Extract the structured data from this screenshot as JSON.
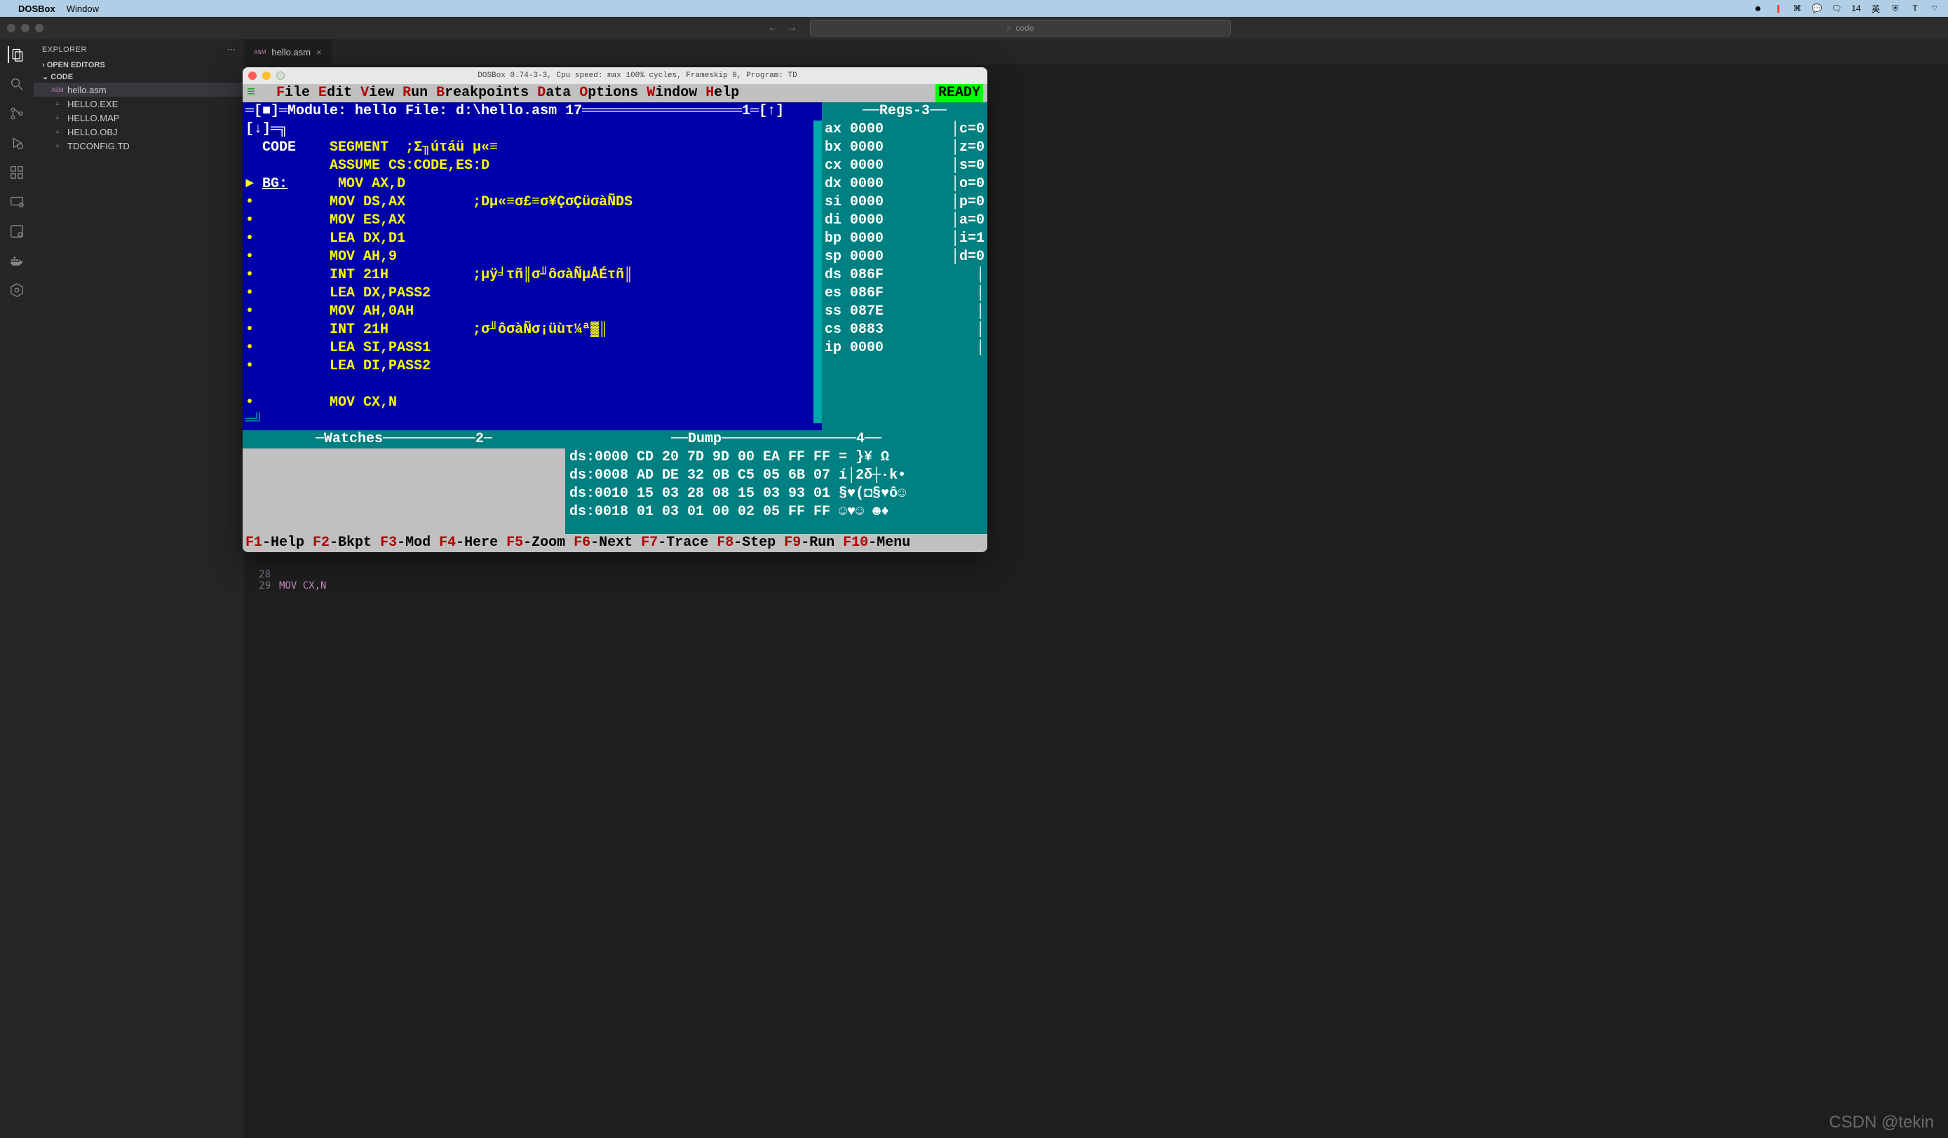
{
  "mac_menu": {
    "app": "DOSBox",
    "items": [
      "Window"
    ],
    "right_status": "14"
  },
  "vsc": {
    "search_placeholder": "code",
    "explorer": {
      "title": "EXPLORER",
      "sections": {
        "open_editors": "OPEN EDITORS",
        "code": "CODE"
      },
      "files": [
        {
          "name": "hello.asm",
          "icon": "asm",
          "active": true
        },
        {
          "name": "HELLO.EXE",
          "icon": "txt"
        },
        {
          "name": "HELLO.MAP",
          "icon": "txt"
        },
        {
          "name": "HELLO.OBJ",
          "icon": "txt"
        },
        {
          "name": "TDCONFIG.TD",
          "icon": "txt"
        }
      ]
    },
    "tab": {
      "label": "hello.asm",
      "icon_label": "ASM"
    },
    "editor_lines": [
      {
        "no": "28",
        "code": ""
      },
      {
        "no": "29",
        "code": "MOV CX,N"
      }
    ]
  },
  "dosbox": {
    "title": "DOSBox 0.74-3-3, Cpu speed: max 100% cycles, Frameskip  0, Program:     TD",
    "menu": [
      "File",
      "Edit",
      "View",
      "Run",
      "Breakpoints",
      "Data",
      "Options",
      "Window",
      "Help"
    ],
    "ready": "READY",
    "module_title": "═[■]═Module: hello File: d:\\hello.asm 17═══════════════════1═[↑][↓]═╗",
    "code_lines": [
      {
        "marker": " ",
        "label": "CODE",
        "instr": "SEGMENT  ;Σ╖úτáü µ«≡"
      },
      {
        "marker": " ",
        "label": "",
        "instr": "ASSUME CS:CODE,ES:D"
      },
      {
        "marker": "►",
        "label": "BG:",
        "instr": "MOV AX,D",
        "underline": true
      },
      {
        "marker": "•",
        "label": "",
        "instr": "MOV DS,AX        ;Dµ«≡σ£≡σ¥ÇσÇüσàÑDS"
      },
      {
        "marker": "•",
        "label": "",
        "instr": "MOV ES,AX"
      },
      {
        "marker": "•",
        "label": "",
        "instr": "LEA DX,D1"
      },
      {
        "marker": "•",
        "label": "",
        "instr": "MOV AH,9"
      },
      {
        "marker": "•",
        "label": "",
        "instr": "INT 21H          ;µÿ╛τñ║σ╜ôσàÑµÅÉτñ║"
      },
      {
        "marker": "•",
        "label": "",
        "instr": "LEA DX,PASS2"
      },
      {
        "marker": "•",
        "label": "",
        "instr": "MOV AH,0AH"
      },
      {
        "marker": "•",
        "label": "",
        "instr": "INT 21H          ;σ╜ôσàÑσ¡üùτ¼ª▓║"
      },
      {
        "marker": "•",
        "label": "",
        "instr": "LEA SI,PASS1"
      },
      {
        "marker": "•",
        "label": "",
        "instr": "LEA DI,PASS2"
      },
      {
        "marker": " ",
        "label": "",
        "instr": ""
      },
      {
        "marker": "•",
        "label": "",
        "instr": "MOV CX,N"
      }
    ],
    "regs_title": "Regs-3",
    "regs": [
      {
        "l": "ax 0000",
        "r": "c=0"
      },
      {
        "l": "bx 0000",
        "r": "z=0"
      },
      {
        "l": "cx 0000",
        "r": "s=0"
      },
      {
        "l": "dx 0000",
        "r": "o=0"
      },
      {
        "l": "si 0000",
        "r": "p=0"
      },
      {
        "l": "di 0000",
        "r": "a=0"
      },
      {
        "l": "bp 0000",
        "r": "i=1"
      },
      {
        "l": "sp 0000",
        "r": "d=0"
      },
      {
        "l": "ds 086F",
        "r": ""
      },
      {
        "l": "es 086F",
        "r": ""
      },
      {
        "l": "ss 087E",
        "r": ""
      },
      {
        "l": "cs 0883",
        "r": ""
      },
      {
        "l": "ip 0000",
        "r": ""
      }
    ],
    "watches_title": "─Watches───────────2─",
    "dump_title": "──Dump────────────────4──",
    "dump_lines": [
      "ds:0000 CD 20 7D 9D 00 EA FF FF = }¥ Ω",
      "ds:0008 AD DE 32 0B C5 05 6B 07 í│2δ┼∙k•",
      "ds:0010 15 03 28 08 15 03 93 01 §♥(◘§♥ô☺",
      "ds:0018 01 03 01 00 02 05 FF FF ☺♥☺ ☻♦"
    ],
    "fkeys": [
      {
        "f": "F1",
        "l": "-Help "
      },
      {
        "f": "F2",
        "l": "-Bkpt "
      },
      {
        "f": "F3",
        "l": "-Mod "
      },
      {
        "f": "F4",
        "l": "-Here "
      },
      {
        "f": "F5",
        "l": "-Zoom "
      },
      {
        "f": "F6",
        "l": "-Next "
      },
      {
        "f": "F7",
        "l": "-Trace "
      },
      {
        "f": "F8",
        "l": "-Step "
      },
      {
        "f": "F9",
        "l": "-Run "
      },
      {
        "f": "F10",
        "l": "-Menu"
      }
    ]
  },
  "watermark": "CSDN @tekin"
}
